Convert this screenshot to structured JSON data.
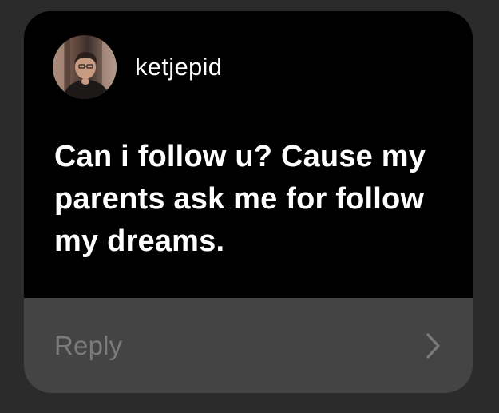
{
  "post": {
    "username": "ketjepid",
    "message": "Can i follow u? Cause my parents ask me for follow my dreams."
  },
  "reply": {
    "placeholder": "Reply"
  },
  "icons": {
    "avatar": "profile-photo",
    "send": "chevron-right-icon"
  },
  "colors": {
    "card_background": "#000000",
    "reply_background": "#444444",
    "page_background": "#2b2b2b",
    "text": "#ffffff",
    "placeholder": "#7b7b7b"
  }
}
